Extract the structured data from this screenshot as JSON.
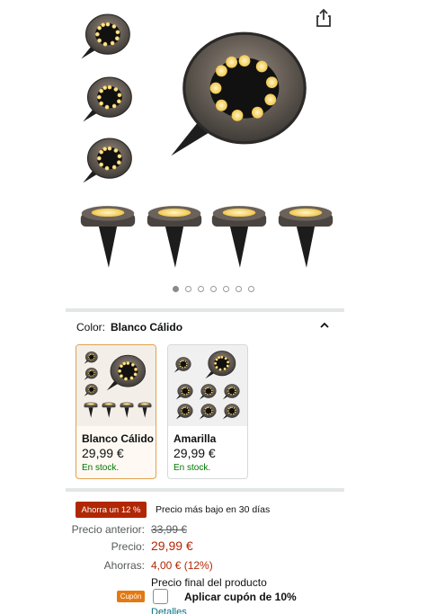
{
  "icons": {
    "share": "share-icon",
    "chevron": "chevron-up-icon"
  },
  "gallery": {
    "dot_count": 7,
    "active_dot": 1
  },
  "color_selector": {
    "label": "Color:",
    "selected_value": "Blanco Cálido",
    "options": [
      {
        "name": "Blanco Cálido",
        "price": "29,99 €",
        "stock": "En stock."
      },
      {
        "name": "Amarilla",
        "price": "29,99 €",
        "stock": "En stock."
      }
    ]
  },
  "deal": {
    "badge": "Ahorra un 12 %",
    "note": "Precio más bajo en 30 días"
  },
  "pricing": {
    "previous_label": "Precio anterior:",
    "previous_value": "33,99 €",
    "price_label": "Precio:",
    "price_value": "29,99 €",
    "savings_label": "Ahorras:",
    "savings_value": "4,00 € (12%)",
    "final_note": "Precio final del producto"
  },
  "coupon": {
    "badge": "Cupón",
    "text": "Aplicar cupón de 10%",
    "details_link": "Detalles"
  },
  "colors": {
    "deal_red": "#b12704",
    "stock_green": "#007600",
    "coupon_orange": "#e47911",
    "link_teal": "#007185",
    "selected_border": "#e0a04c"
  }
}
